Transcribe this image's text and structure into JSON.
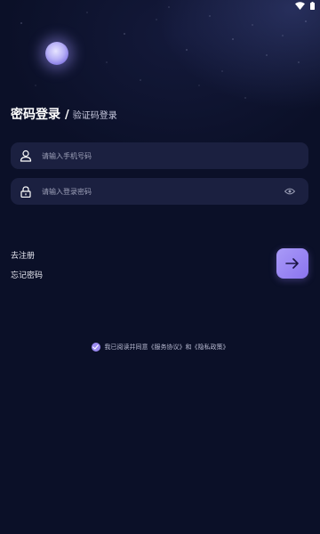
{
  "header": {
    "title_active": "密码登录",
    "title_separator": "/",
    "title_alternate": "验证码登录"
  },
  "form": {
    "phone_placeholder": "请输入手机号码",
    "password_placeholder": "请输入登录密码"
  },
  "links": {
    "register": "去注册",
    "forgot_password": "忘记密码"
  },
  "agreement": {
    "prefix": "我已阅读并同意",
    "service_terms": "《服务协议》",
    "conjunction": "和",
    "privacy_policy": "《隐私政策》",
    "checked": true
  },
  "icons": {
    "phone_field": "user-icon",
    "password_field": "lock-icon",
    "password_toggle": "eye-icon",
    "submit": "arrow-right-icon",
    "status": [
      "wifi-icon",
      "battery-icon"
    ]
  },
  "colors": {
    "background": "#0b1028",
    "field_background": "#1b2040",
    "accent": "#9c8bf2"
  }
}
